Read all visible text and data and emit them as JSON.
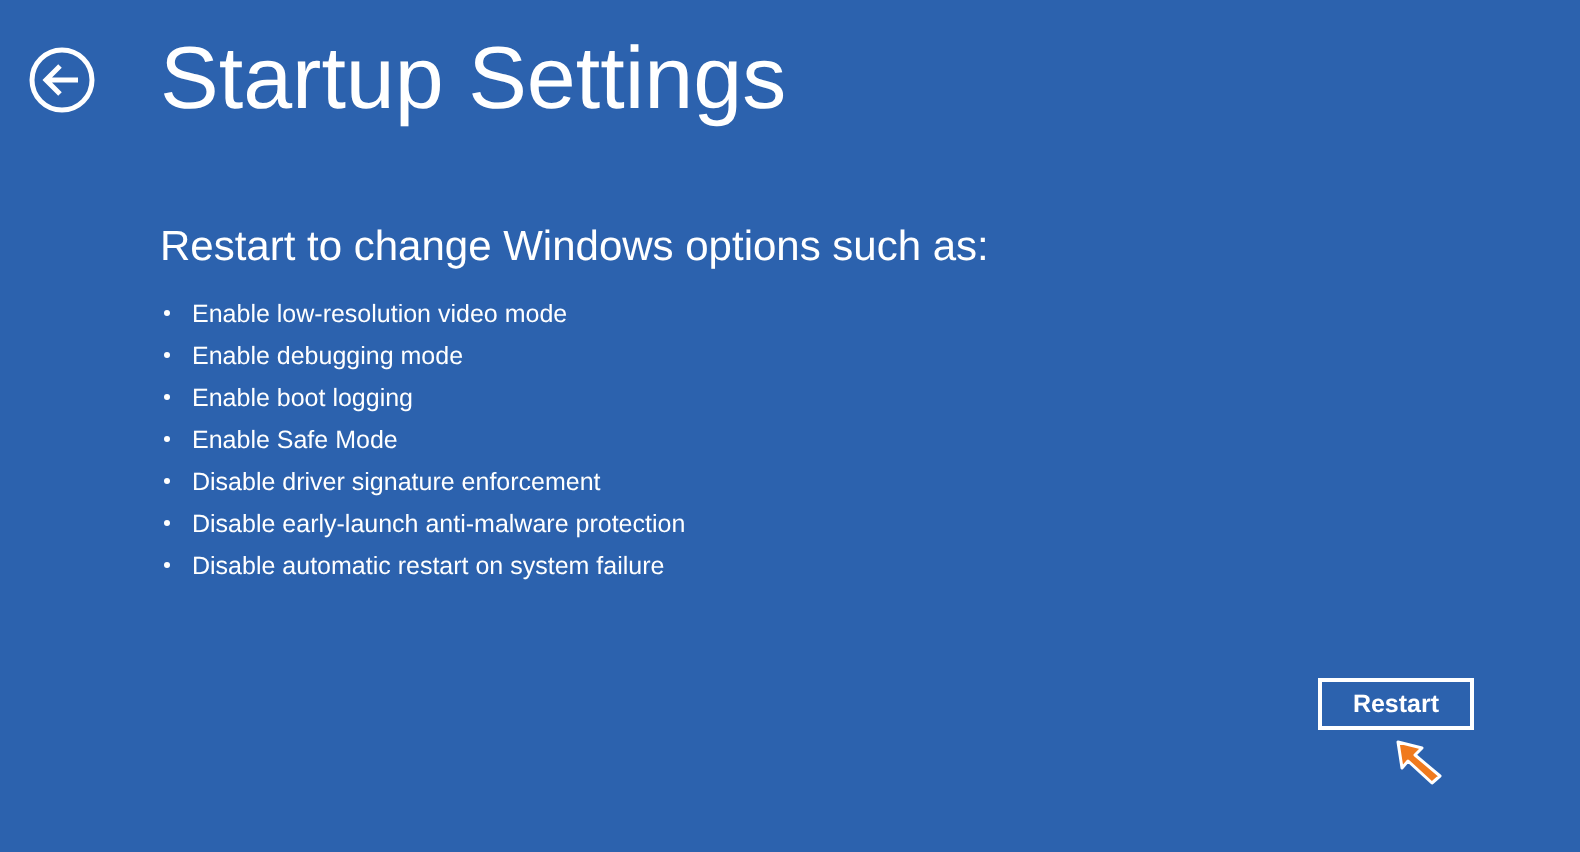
{
  "title": "Startup Settings",
  "subtitle": "Restart to change Windows options such as:",
  "options": [
    "Enable low-resolution video mode",
    "Enable debugging mode",
    "Enable boot logging",
    "Enable Safe Mode",
    "Disable driver signature enforcement",
    "Disable early-launch anti-malware protection",
    "Disable automatic restart on system failure"
  ],
  "restart_button": "Restart"
}
